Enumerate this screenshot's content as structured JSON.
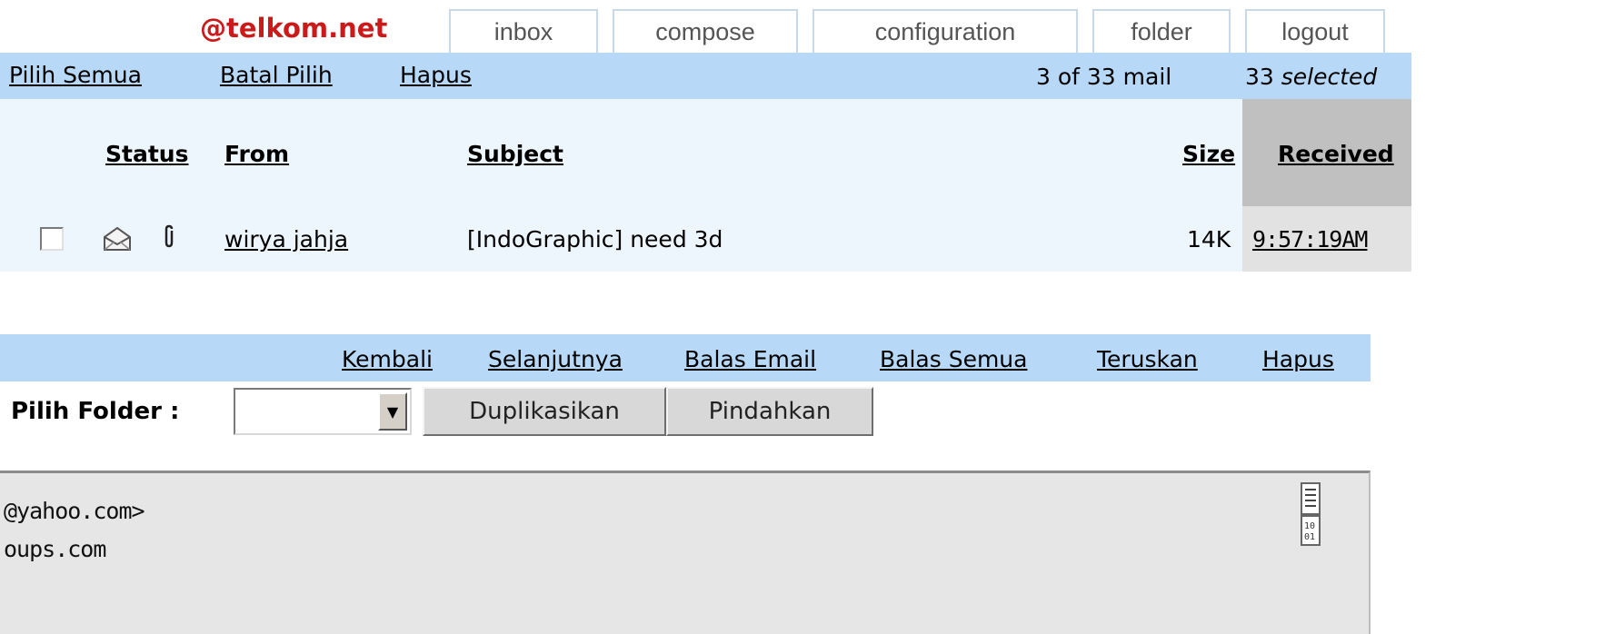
{
  "header": {
    "brand": "@telkom.net",
    "nav": [
      {
        "label": "inbox"
      },
      {
        "label": "compose"
      },
      {
        "label": "configuration"
      },
      {
        "label": "folder"
      },
      {
        "label": "logout"
      }
    ]
  },
  "toolbar": {
    "select_all": "Pilih Semua",
    "deselect": "Batal Pilih",
    "delete": "Hapus",
    "mail_count": "3 of 33 mail",
    "selected_count": "33",
    "selected_word": "selected"
  },
  "table": {
    "columns": [
      "Status",
      "From",
      "Subject",
      "Size",
      "Received"
    ],
    "rows": [
      {
        "checked": false,
        "status_icon": "envelope-open-icon",
        "attachment_icon": "paperclip-icon",
        "from": "wirya jahja",
        "subject": "[IndoGraphic] need 3d",
        "size": "14K",
        "received": "9:57:19AM"
      }
    ]
  },
  "message_actions": {
    "back": "Kembali",
    "next": "Selanjutnya",
    "reply": "Balas Email",
    "reply_all": "Balas Semua",
    "forward": "Teruskan",
    "delete": "Hapus"
  },
  "folder": {
    "label": "Pilih Folder :",
    "selected": "",
    "copy_button": "Duplikasikan",
    "move_button": "Pindahkan"
  },
  "preview": {
    "lines": [
      "@yahoo.com>",
      "oups.com"
    ]
  },
  "colors": {
    "brand": "#cc1a1a",
    "bar": "#b7d9f7",
    "sort_column": "#c0c0c0"
  }
}
